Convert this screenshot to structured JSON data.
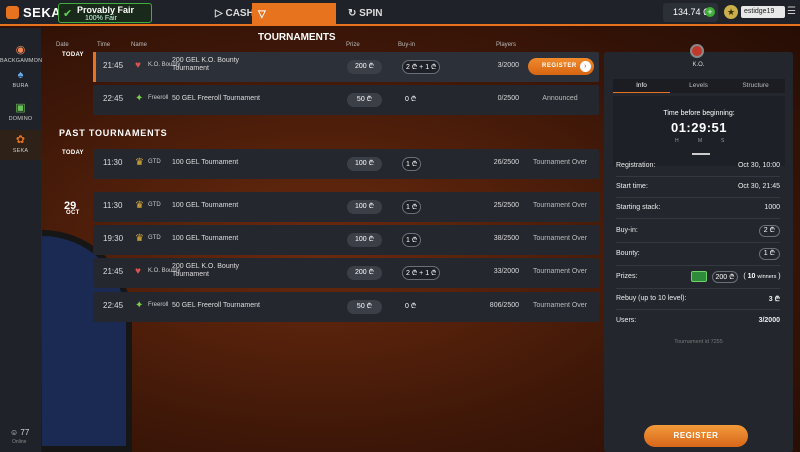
{
  "topbar": {
    "logo": "SEKA",
    "provably_fair_title": "Provably Fair",
    "provably_fair_sub": "100% Fair",
    "tabs": [
      {
        "label": "CASH",
        "icon": "play-icon"
      },
      {
        "label": "TOURNAMENTS",
        "icon": "trophy-icon"
      },
      {
        "label": "SPIN",
        "icon": "spin-icon"
      }
    ],
    "active_tab": "TOURNAMENTS",
    "balance": "134.74 ₾",
    "username": "estidge19"
  },
  "sidebar": {
    "items": [
      {
        "label": "BACKGAMMON",
        "icon": "backgammon-icon"
      },
      {
        "label": "BURA",
        "icon": "bura-icon"
      },
      {
        "label": "DOMINO",
        "icon": "domino-icon"
      },
      {
        "label": "SEKA",
        "icon": "seka-icon"
      }
    ],
    "online_count": "77",
    "online_label": "Online"
  },
  "columns": {
    "date": "Date",
    "time": "Time",
    "name": "Name",
    "prize": "Prize",
    "buyin": "Buy-in",
    "players": "Players"
  },
  "upcoming": {
    "date_label": "TODAY",
    "rows": [
      {
        "time": "21:45",
        "type": "K.O. Bounty",
        "name": "200 GEL K.O. Bounty Tournament",
        "prize": "200 ₾",
        "buyin": "2 ₾ + 1 ₾",
        "players": "3/2000",
        "action": "REGISTER"
      },
      {
        "time": "22:45",
        "type": "Freeroll",
        "name": "50 GEL Freeroll Tournament",
        "prize": "50 ₾",
        "buyin": "0 ₾",
        "players": "0/2500",
        "status": "Announced"
      }
    ]
  },
  "past": {
    "title": "PAST TOURNAMENTS",
    "today_label": "TODAY",
    "today_rows": [
      {
        "time": "11:30",
        "type": "GTD",
        "name": "100 GEL Tournament",
        "prize": "100 ₾",
        "buyin": "1 ₾",
        "players": "26/2500",
        "status": "Tournament Over"
      }
    ],
    "date_day": "29",
    "date_month": "OCT",
    "oct29_rows": [
      {
        "time": "11:30",
        "type": "GTD",
        "name": "100 GEL Tournament",
        "prize": "100 ₾",
        "buyin": "1 ₾",
        "players": "25/2500",
        "status": "Tournament Over"
      },
      {
        "time": "19:30",
        "type": "GTD",
        "name": "100 GEL Tournament",
        "prize": "100 ₾",
        "buyin": "1 ₾",
        "players": "38/2500",
        "status": "Tournament Over"
      },
      {
        "time": "21:45",
        "type": "K.O. Bounty",
        "name": "200 GEL K.O. Bounty Tournament",
        "prize": "200 ₾",
        "buyin": "2 ₾ + 1 ₾",
        "players": "33/2000",
        "status": "Tournament Over"
      },
      {
        "time": "22:45",
        "type": "Freeroll",
        "name": "50 GEL Freeroll Tournament",
        "prize": "50 ₾",
        "buyin": "0 ₾",
        "players": "806/2500",
        "status": "Tournament Over"
      }
    ]
  },
  "panel": {
    "badge": "K.O.",
    "tabs": [
      "Info",
      "Levels",
      "Structure"
    ],
    "active_tab": "Info",
    "time_before_label": "Time before beginning:",
    "countdown": "01:29:51",
    "hms": [
      "H",
      "M",
      "S"
    ],
    "registration_label": "Registration:",
    "registration_value": "Oct 30, 10:00",
    "start_label": "Start time:",
    "start_value": "Oct 30, 21:45",
    "stack_label": "Starting stack:",
    "stack_value": "1000",
    "buyin_label": "Buy-in:",
    "buyin_value": "2 ₾",
    "bounty_label": "Bounty:",
    "bounty_value": "1 ₾",
    "prizes_label": "Prizes:",
    "prizes_value": "200 ₾",
    "winners_count": "10",
    "winners_label": "winners",
    "rebuy_label": "Rebuy (up to 10 level):",
    "rebuy_value": "3 ₾",
    "users_label": "Users:",
    "users_value": "3/2000",
    "footnote": "Tournament id 7255",
    "register_button": "REGISTER"
  },
  "colors": {
    "accent": "#e8731f",
    "panel_bg": "#23262d",
    "row_bg": "#24272e",
    "success": "#3fae3a"
  }
}
